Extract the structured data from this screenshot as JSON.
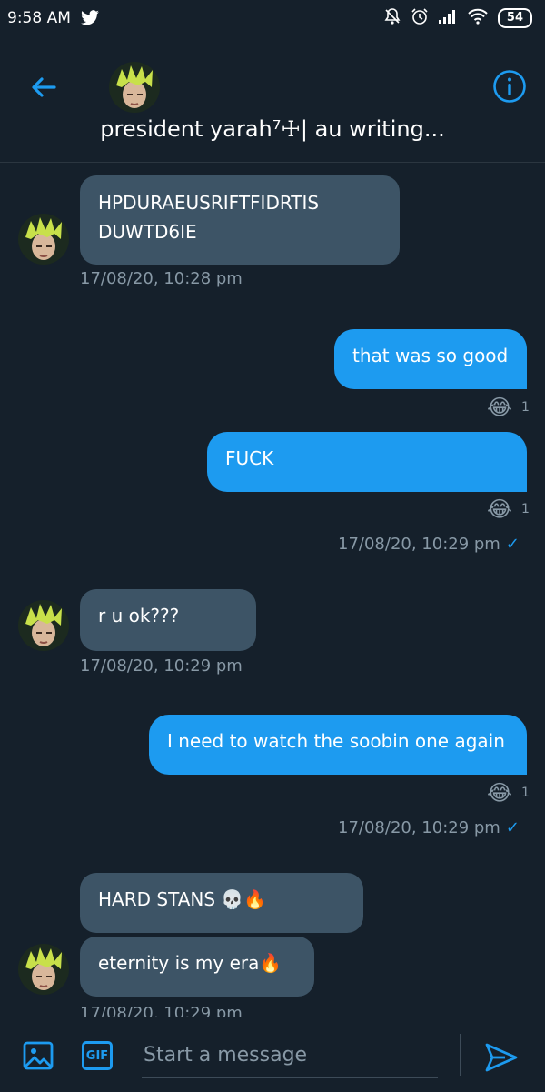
{
  "status_bar": {
    "time": "9:58 AM",
    "battery": "54",
    "icons": [
      "twitter-bird-icon",
      "mute-bell-icon",
      "alarm-icon",
      "signal-icon",
      "wifi-icon",
      "battery-icon"
    ]
  },
  "header": {
    "title": "president yarah⁷☩| au writing..."
  },
  "colors": {
    "background": "#15202b",
    "incoming_bubble": "#3d5466",
    "outgoing_bubble": "#1d9bf0",
    "accent": "#1d9bf0",
    "timestamp": "#8899a6"
  },
  "messages": [
    {
      "direction": "in",
      "text_line1": "HPDURAEUSRIFTFIDRTIS",
      "text_line2": "DUWTD6IE",
      "timestamp": "17/08/20, 10:28 pm"
    },
    {
      "direction": "out",
      "text": "that was so good",
      "reaction": "😂",
      "reaction_count": "1"
    },
    {
      "direction": "out",
      "text": "FUCK",
      "reaction": "😂",
      "reaction_count": "1",
      "timestamp": "17/08/20, 10:29 pm"
    },
    {
      "direction": "in",
      "text": "r u ok???",
      "timestamp": "17/08/20, 10:29 pm"
    },
    {
      "direction": "out",
      "text": "I need to watch the soobin one again",
      "reaction": "😂",
      "reaction_count": "1",
      "timestamp": "17/08/20, 10:29 pm"
    },
    {
      "direction": "in",
      "text": "HARD STANS 💀🔥"
    },
    {
      "direction": "in",
      "text": "eternity is my era🔥",
      "timestamp": "17/08/20, 10:29 pm"
    }
  ],
  "composer": {
    "placeholder": "Start a message",
    "gif_label": "GIF"
  }
}
